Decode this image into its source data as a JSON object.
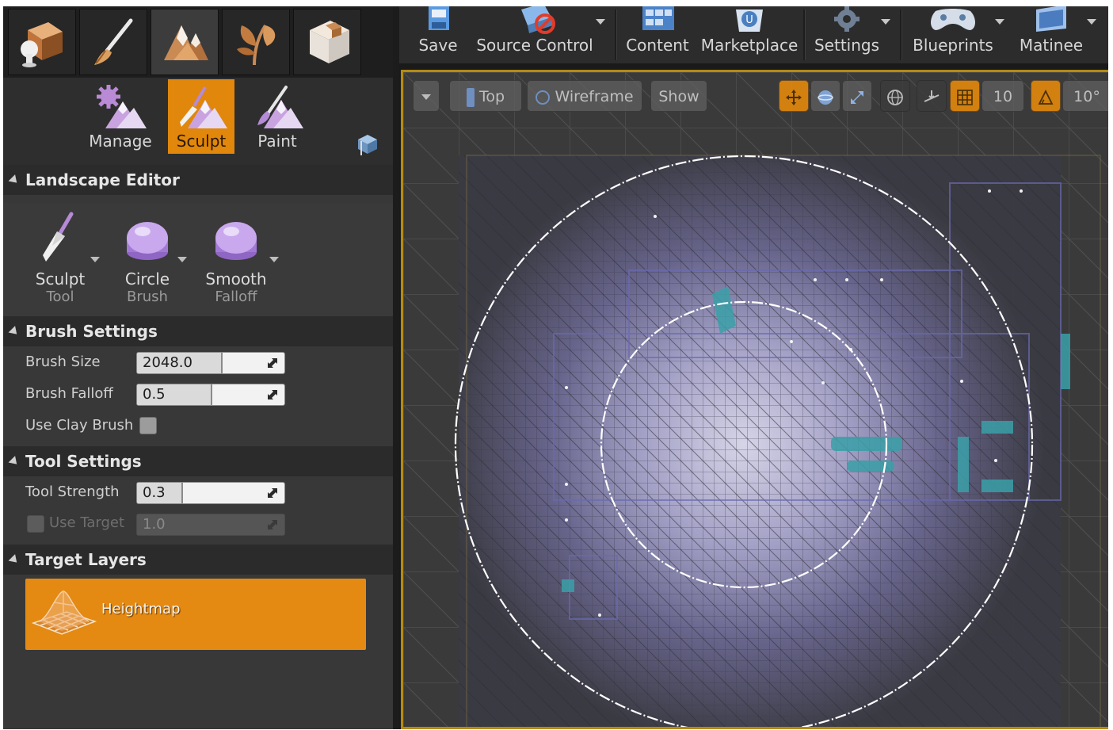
{
  "mode_tabs": [
    {
      "name": "place"
    },
    {
      "name": "paint"
    },
    {
      "name": "landscape",
      "active": true
    },
    {
      "name": "foliage"
    },
    {
      "name": "geometry"
    }
  ],
  "landscape_modes": [
    {
      "label": "Manage"
    },
    {
      "label": "Sculpt",
      "active": true
    },
    {
      "label": "Paint"
    }
  ],
  "panel": {
    "title": "Landscape Editor"
  },
  "tools": {
    "sculpt": {
      "line1": "Sculpt",
      "line2": "Tool"
    },
    "brush": {
      "line1": "Circle",
      "line2": "Brush"
    },
    "falloff": {
      "line1": "Smooth",
      "line2": "Falloff"
    }
  },
  "brush_settings": {
    "header": "Brush Settings",
    "brush_size_label": "Brush Size",
    "brush_size_value": "2048.0",
    "brush_size_fill": 0.57,
    "brush_falloff_label": "Brush Falloff",
    "brush_falloff_value": "0.5",
    "brush_falloff_fill": 0.5,
    "use_clay_label": "Use Clay Brush",
    "use_clay_checked": false
  },
  "tool_settings": {
    "header": "Tool Settings",
    "tool_strength_label": "Tool Strength",
    "tool_strength_value": "0.3",
    "tool_strength_fill": 0.3,
    "use_target_label": "Use Target",
    "use_target_value": "1.0",
    "use_target_checked": false
  },
  "target_layers": {
    "header": "Target Layers",
    "items": [
      {
        "label": "Heightmap",
        "selected": true
      }
    ]
  },
  "toolbar": {
    "save": "Save",
    "source_control": "Source Control",
    "content": "Content",
    "marketplace": "Marketplace",
    "settings": "Settings",
    "blueprints": "Blueprints",
    "matinee": "Matinee"
  },
  "viewport": {
    "view": "Top",
    "mode": "Wireframe",
    "show": "Show",
    "grid_snap": "10",
    "rotation_snap": "10°"
  },
  "colors": {
    "accent": "#e0870c",
    "panel_bg": "#383838",
    "viewport_border": "#b48a10"
  }
}
